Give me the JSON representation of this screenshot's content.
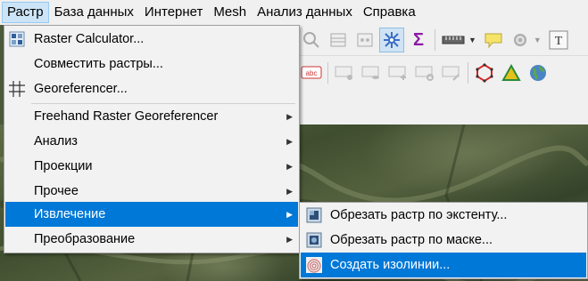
{
  "menubar": {
    "items": [
      {
        "label": "Растр",
        "active": true
      },
      {
        "label": "База данных"
      },
      {
        "label": "Интернет"
      },
      {
        "label": "Mesh"
      },
      {
        "label": "Анализ данных"
      },
      {
        "label": "Справка"
      }
    ]
  },
  "raster_menu": {
    "items": [
      {
        "label": "Raster Calculator...",
        "icon": "raster-calculator-icon"
      },
      {
        "label": "Совместить растры...",
        "icon": "none"
      },
      {
        "label": "Georeferencer...",
        "icon": "georeferencer-grid-icon"
      },
      {
        "label": "Freehand Raster Georeferencer",
        "submenu": true
      },
      {
        "label": "Анализ",
        "submenu": true
      },
      {
        "label": "Проекции",
        "submenu": true
      },
      {
        "label": "Прочее",
        "submenu": true
      },
      {
        "label": "Извлечение",
        "submenu": true,
        "active": true
      },
      {
        "label": "Преобразование",
        "submenu": true
      }
    ]
  },
  "extraction_submenu": {
    "items": [
      {
        "label": "Обрезать растр по экстенту...",
        "icon": "clip-raster-icon"
      },
      {
        "label": "Обрезать растр по маске...",
        "icon": "clip-raster-mask-icon"
      },
      {
        "label": "Создать изолинии...",
        "icon": "contour-icon",
        "active": true
      }
    ]
  },
  "toolbar_labels": {
    "label_icon_text": "abc",
    "text_annotation": "T"
  },
  "colors": {
    "highlight": "#0078d7",
    "menu_bg": "#f2f2f2",
    "active_menubar": "#cce4f7"
  }
}
